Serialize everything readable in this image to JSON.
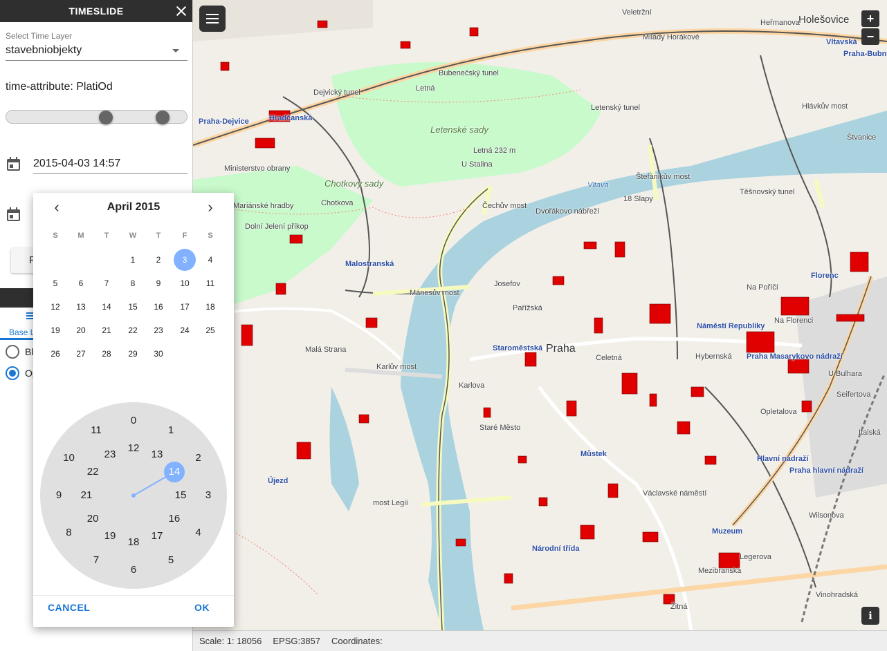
{
  "panel": {
    "title": "TIMESLIDE",
    "select_label": "Select Time Layer",
    "select_value": "stavebniobjekty",
    "time_attribute": "time-attribute: PlatiOd",
    "slider": {
      "min_fraction": 0.55,
      "max_fraction": 0.89
    },
    "date_value": "2015-04-03 14:57",
    "partial_button_label": "F",
    "tab_label": "Base L",
    "radios": [
      {
        "label": "Bl",
        "checked": false
      },
      {
        "label": "Op",
        "checked": true
      }
    ]
  },
  "picker": {
    "month_title": "April 2015",
    "prev_icon": "chevron-left-icon",
    "next_icon": "chevron-right-icon",
    "weekdays": [
      "S",
      "M",
      "T",
      "W",
      "T",
      "F",
      "S"
    ],
    "first_weekday_index": 3,
    "days_in_month": 30,
    "selected_day": 3,
    "clock_outer": [
      "0",
      "1",
      "2",
      "3",
      "4",
      "5",
      "6",
      "7",
      "8",
      "9",
      "10",
      "11"
    ],
    "clock_inner": [
      "12",
      "13",
      "14",
      "15",
      "16",
      "17",
      "18",
      "19",
      "20",
      "21",
      "22",
      "23"
    ],
    "selected_hour": "14",
    "cancel_label": "CANCEL",
    "ok_label": "OK",
    "accent": "#82b1ff",
    "button_color": "#1976d2"
  },
  "map": {
    "menu_icon": "hamburger-menu-icon",
    "zoom_in": "+",
    "zoom_out": "−",
    "info": "i",
    "labels": [
      "Holešovice",
      "Veletržní",
      "Heřmanova",
      "Milady Horákové",
      "Letná",
      "Letenské sady",
      "Letná 232 m",
      "U Stalina",
      "Bubenečský tunel",
      "Dejvický tunel",
      "Letenský tunel",
      "Praha-Dejvice",
      "Hradčanská",
      "Štefánikův most",
      "Těšnovský tunel",
      "Čechův most",
      "Dvořákovo nábřeží",
      "Vltava",
      "Malostranská",
      "Mánesův most",
      "Josefov",
      "Praha",
      "Staroměstská",
      "Staré Město",
      "Karlův most",
      "Malá Strana",
      "Můstek",
      "Náměstí Republiky",
      "Praha Masarykovo nádraží",
      "Florenc",
      "Hlavní nádraží",
      "Praha hlavní nádraží",
      "Václavské náměstí",
      "Národní třída",
      "Muzeum",
      "Újezd",
      "most Legií",
      "Hlávkův most",
      "Štvanice",
      "Vltavská",
      "Praha-Bubny/Vltavská",
      "Chotkova",
      "Chotkovy sady",
      "Ministerstvo obrany",
      "Mariánské hradby",
      "Dolní Jelení příkop",
      "18 Slapy",
      "Wilsonova",
      "Legerova",
      "Mezibranská",
      "Žitná",
      "Vinohradská",
      "Na Poříčí",
      "Opletalova",
      "U Bulhara",
      "Seifertova",
      "Italská",
      "Na Florenci",
      "Hybernská",
      "Celetná",
      "Pařížská",
      "Karlova"
    ]
  },
  "status": {
    "scale": "Scale: 1: 18056",
    "epsg": "EPSG:3857",
    "coordinates": "Coordinates:"
  }
}
